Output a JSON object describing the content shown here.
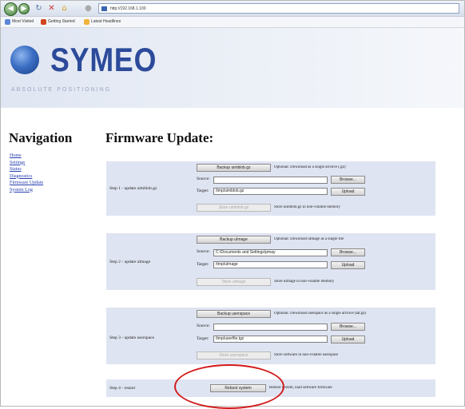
{
  "browser": {
    "address": "http://192.168.1.100",
    "bookmarks": [
      "Most Visited",
      "Getting Started",
      "Latest Headlines"
    ]
  },
  "header": {
    "logo_text": "SYMEO",
    "logo_sub": "ABSOLUTE POSITIONING",
    "brand_color": "#2c4a9a"
  },
  "navigation": {
    "title": "Navigation",
    "items": [
      "Home",
      "Settings",
      "Status",
      "Diagnostics",
      "Firmware Update",
      "System Log"
    ]
  },
  "page_title": "Firmware Update:",
  "steps": [
    {
      "label": "Step 1 - update uimblob.gz",
      "backup_label": "Backup uimblob.gz",
      "backup_desc": "Optional: Download as a single archive (.gz)",
      "source_label": "Source:",
      "source_value": "",
      "browse_label": "Browse...",
      "target_label": "Target:",
      "target_value": "/tmp/uimblob.gz",
      "upload_label": "Upload",
      "store_label": "Store uimblob.gz",
      "store_desc": "Store uimblob.gz in non-volatile memory"
    },
    {
      "label": "Step 2 - update uImage",
      "backup_label": "Backup uImage",
      "backup_desc": "Optional: Download uImage as a single file",
      "source_label": "Source:",
      "source_value": "C:\\Documents and Settings\\pmay",
      "browse_label": "Browse...",
      "target_label": "Target:",
      "target_value": "/tmp/uImage",
      "upload_label": "Upload",
      "store_label": "Store uImage",
      "store_desc": "Store uImage in non-volatile memory"
    },
    {
      "label": "Step 3 - update userspace",
      "backup_label": "Backup userspace",
      "backup_desc": "Optional: Download userspace as a single archive (tar.gz)",
      "source_label": "Source:",
      "source_value": "",
      "browse_label": "Browse...",
      "target_label": "Target:",
      "target_value": "/tmp/userfile.tgz",
      "upload_label": "Upload",
      "store_label": "Store userspace",
      "store_desc": "Store software in non-volatile userspace"
    }
  ],
  "step4": {
    "label": "Step 4 - restart",
    "button_label": "Reboot system",
    "desc": "Reboot system, load software firmware"
  },
  "annotation_color": "#d31b1b"
}
